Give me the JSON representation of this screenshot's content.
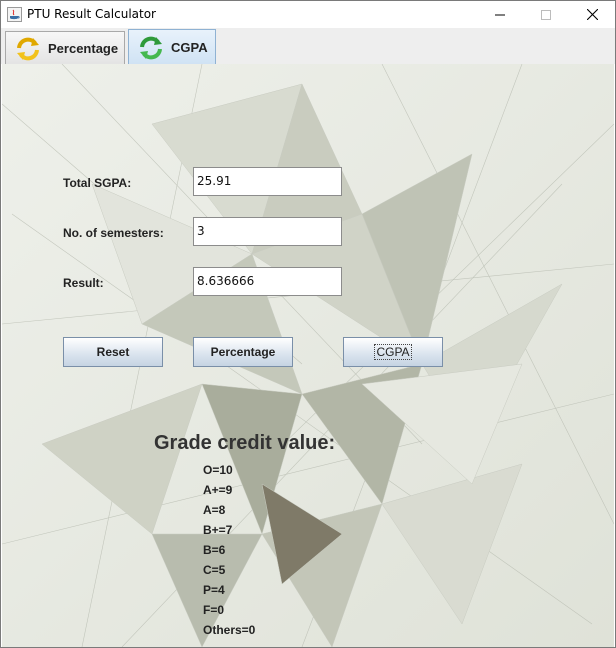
{
  "window": {
    "title": "PTU Result Calculator"
  },
  "tabs": [
    {
      "label": "Percentage",
      "icon": "refresh-yellow-icon",
      "selected": false
    },
    {
      "label": "CGPA",
      "icon": "refresh-green-icon",
      "selected": true
    }
  ],
  "form": {
    "total_sgpa_label": "Total SGPA:",
    "total_sgpa_value": "25.91",
    "semesters_label": "No. of semesters:",
    "semesters_value": "3",
    "result_label": "Result:",
    "result_value": "8.636666"
  },
  "buttons": {
    "reset": "Reset",
    "percentage": "Percentage",
    "cgpa": "CGPA"
  },
  "grades": {
    "title": "Grade credit value:",
    "items": [
      "O=10",
      "A+=9",
      "A=8",
      "B+=7",
      "B=6",
      "C=5",
      "P=4",
      "F=0",
      "Others=0"
    ]
  },
  "colors": {
    "panel_background": "#e9ebe4",
    "tab_selected": "#cfe2f4"
  }
}
